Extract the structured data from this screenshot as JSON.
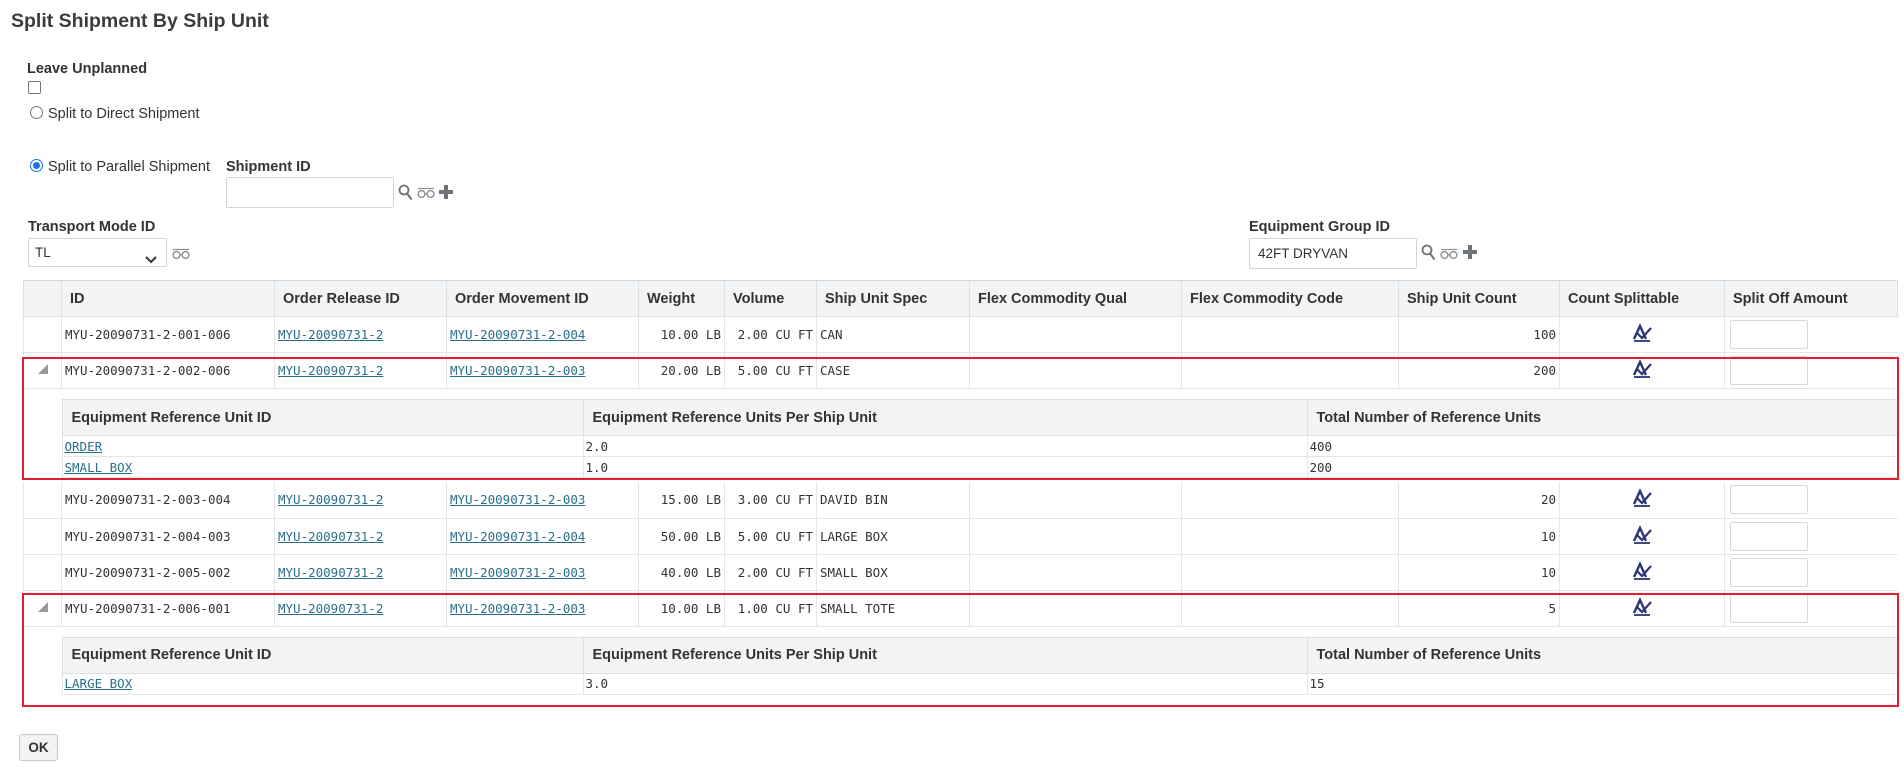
{
  "page": {
    "title": "Split Shipment By Ship Unit"
  },
  "options": {
    "leave_unplanned_label": "Leave Unplanned",
    "leave_unplanned_checked": false,
    "direct_label": "Split to Direct Shipment",
    "parallel_label": "Split to Parallel Shipment",
    "selected": "parallel"
  },
  "shipment": {
    "label": "Shipment ID",
    "value": ""
  },
  "transport_mode": {
    "label": "Transport Mode ID",
    "value": "TL"
  },
  "equipment_group": {
    "label": "Equipment Group ID",
    "value": "42FT DRYVAN"
  },
  "grid": {
    "columns": [
      "ID",
      "Order Release ID",
      "Order Movement ID",
      "Weight",
      "Volume",
      "Ship Unit Spec",
      "Flex Commodity Qual",
      "Flex Commodity Code",
      "Ship Unit Count",
      "Count Splittable",
      "Split Off Amount"
    ],
    "rows": [
      {
        "id": "MYU-20090731-2-001-006",
        "release": "MYU-20090731-2",
        "movement": "MYU-20090731-2-004",
        "weight": "10.00 LB",
        "volume": "2.00 CU FT",
        "spec": "CAN",
        "qual": "",
        "code": "",
        "count": "100"
      },
      {
        "id": "MYU-20090731-2-002-006",
        "release": "MYU-20090731-2",
        "movement": "MYU-20090731-2-003",
        "weight": "20.00 LB",
        "volume": "5.00 CU FT",
        "spec": "CASE",
        "qual": "",
        "code": "",
        "count": "200"
      },
      {
        "id": "MYU-20090731-2-003-004",
        "release": "MYU-20090731-2",
        "movement": "MYU-20090731-2-003",
        "weight": "15.00 LB",
        "volume": "3.00 CU FT",
        "spec": "DAVID BIN",
        "qual": "",
        "code": "",
        "count": "20"
      },
      {
        "id": "MYU-20090731-2-004-003",
        "release": "MYU-20090731-2",
        "movement": "MYU-20090731-2-004",
        "weight": "50.00 LB",
        "volume": "5.00 CU FT",
        "spec": "LARGE BOX",
        "qual": "",
        "code": "",
        "count": "10"
      },
      {
        "id": "MYU-20090731-2-005-002",
        "release": "MYU-20090731-2",
        "movement": "MYU-20090731-2-003",
        "weight": "40.00 LB",
        "volume": "2.00 CU FT",
        "spec": "SMALL BOX",
        "qual": "",
        "code": "",
        "count": "10"
      },
      {
        "id": "MYU-20090731-2-006-001",
        "release": "MYU-20090731-2",
        "movement": "MYU-20090731-2-003",
        "weight": "10.00 LB",
        "volume": "1.00 CU FT",
        "spec": "SMALL TOTE",
        "qual": "",
        "code": "",
        "count": "5"
      }
    ]
  },
  "detail": {
    "columns": [
      "Equipment Reference Unit ID",
      "Equipment Reference Units Per Ship Unit",
      "Total Number of Reference Units"
    ],
    "row2": [
      {
        "unit": "ORDER",
        "per": "2.0",
        "total": "400"
      },
      {
        "unit": "SMALL BOX",
        "per": "1.0",
        "total": "200"
      }
    ],
    "row6": [
      {
        "unit": "LARGE BOX",
        "per": "3.0",
        "total": "15"
      }
    ]
  },
  "icons": {
    "search": "magnifier-icon",
    "view": "glasses-icon",
    "add": "plus-icon",
    "splittable": "count-splittable-icon",
    "expand": "triangle-expanded-icon"
  },
  "colors": {
    "link": "#2a6f8a",
    "highlight": "#e0202c",
    "radio_selected": "#1a73e8",
    "splittable_icon": "#2c3576"
  },
  "buttons": {
    "ok": "OK"
  }
}
